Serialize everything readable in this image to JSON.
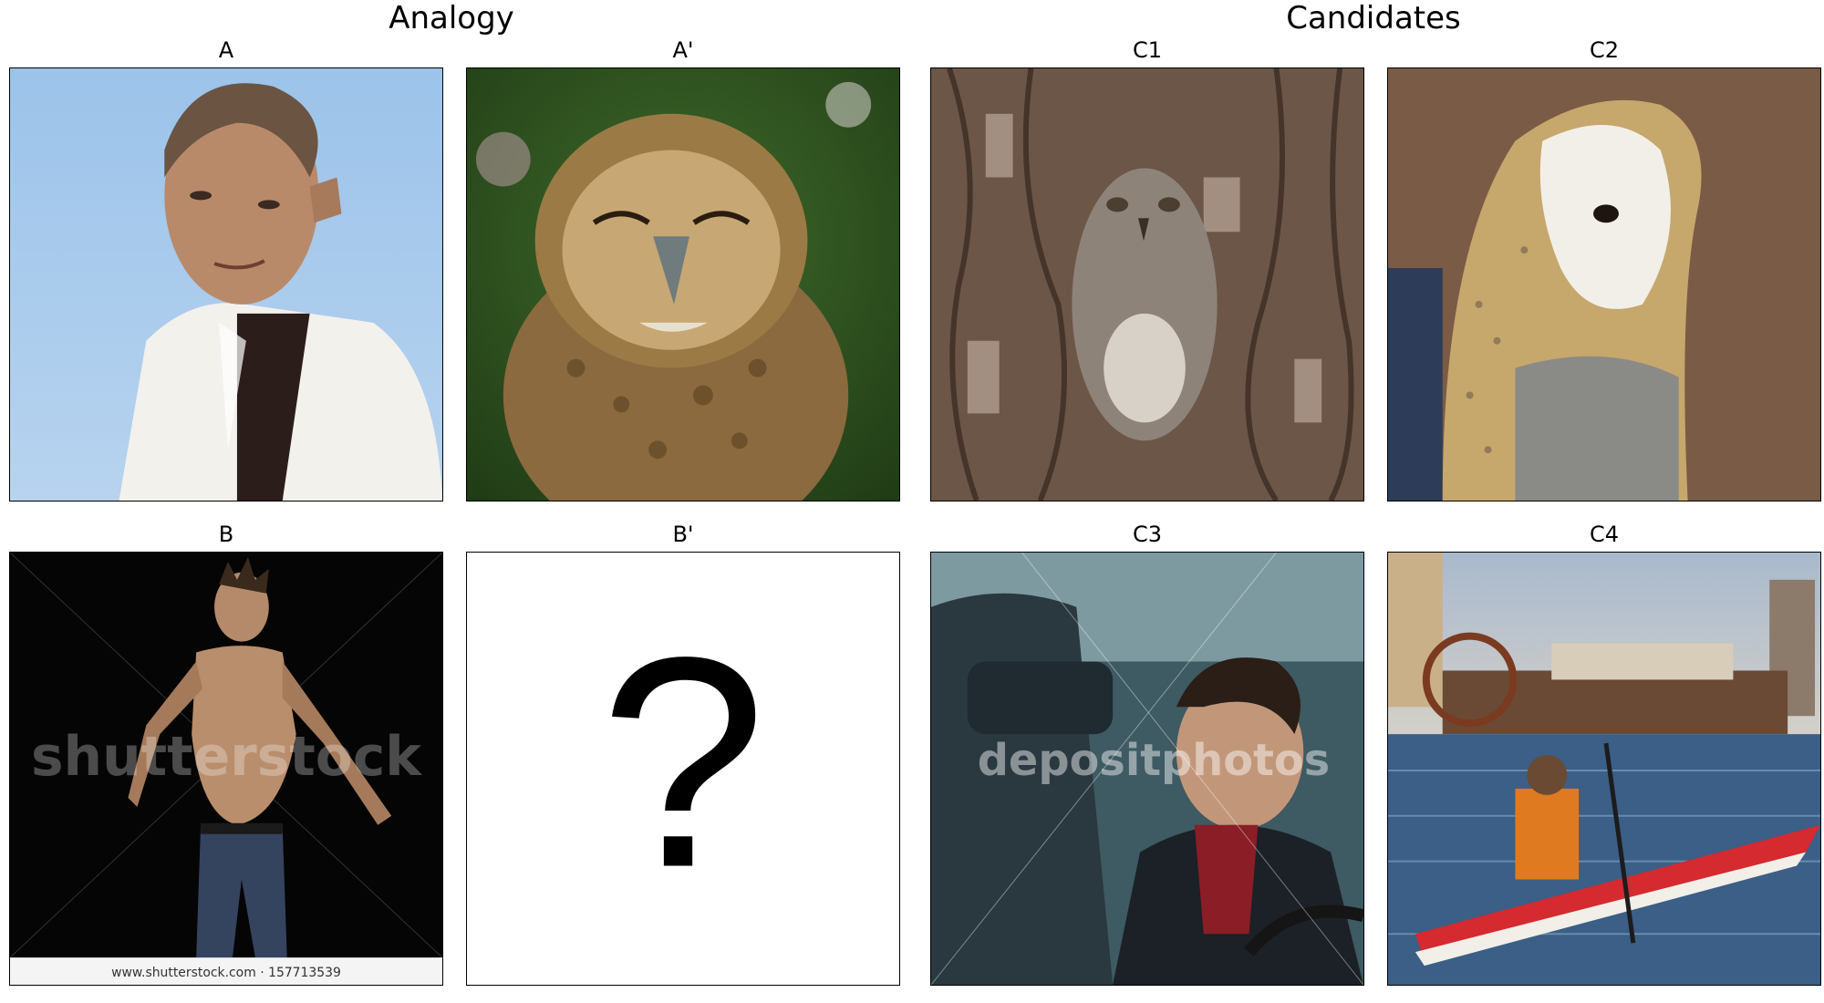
{
  "sections": {
    "analogy_title": "Analogy",
    "candidates_title": "Candidates"
  },
  "panels": {
    "a": {
      "label": "A"
    },
    "a_prime": {
      "label": "A'"
    },
    "b": {
      "label": "B",
      "watermark": "shutterstock",
      "footer": "www.shutterstock.com · 157713539"
    },
    "b_prime": {
      "label": "B'",
      "glyph": "?"
    },
    "c1": {
      "label": "C1"
    },
    "c2": {
      "label": "C2"
    },
    "c3": {
      "label": "C3",
      "watermark": "depositphotos"
    },
    "c4": {
      "label": "C4"
    }
  }
}
